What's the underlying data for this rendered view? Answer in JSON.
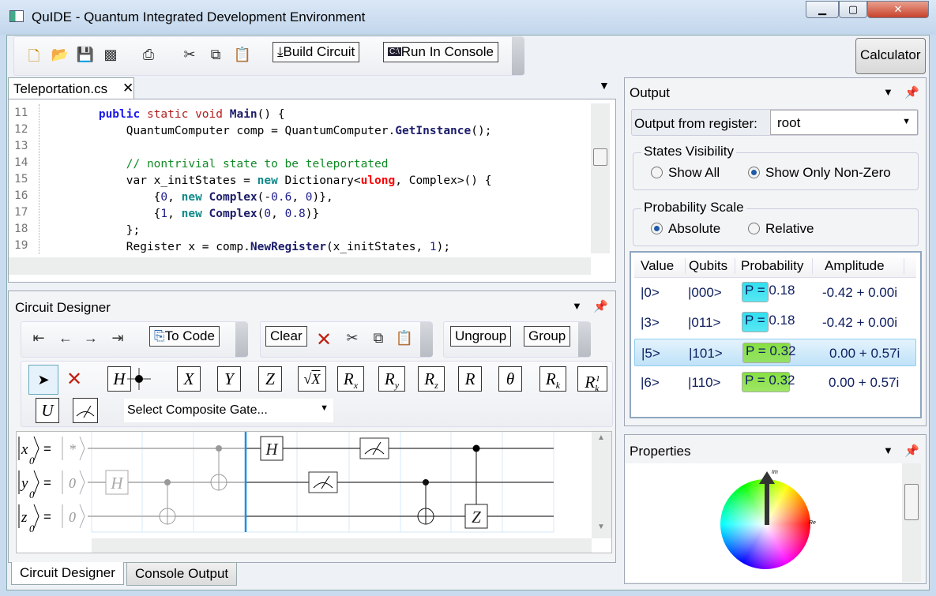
{
  "window": {
    "title": "QuIDE - Quantum Integrated Development Environment",
    "controls": [
      "minimize",
      "maximize",
      "close"
    ]
  },
  "toolbar": {
    "icons": [
      "new-file-icon",
      "open-file-icon",
      "save-icon",
      "save-all-icon",
      "print-icon",
      "cut-icon",
      "copy-icon",
      "paste-icon"
    ],
    "build_circuit": "Build Circuit",
    "run_in_console": "Run In Console",
    "calculator": "Calculator"
  },
  "editor": {
    "tab": "Teleportation.cs",
    "lines": [
      {
        "n": "11",
        "tokens": [
          [
            "        ",
            ""
          ],
          [
            "public",
            "kw"
          ],
          [
            " static void ",
            "red"
          ],
          [
            "Main",
            "m"
          ],
          [
            "() {",
            ""
          ]
        ]
      },
      {
        "n": "12",
        "tokens": [
          [
            "            QuantumComputer comp = QuantumComputer.",
            ""
          ],
          [
            "GetInstance",
            "m"
          ],
          [
            "();",
            ""
          ]
        ]
      },
      {
        "n": "13",
        "tokens": []
      },
      {
        "n": "14",
        "tokens": [
          [
            "            // nontrivial state to be teleportated",
            "cm"
          ]
        ]
      },
      {
        "n": "15",
        "tokens": [
          [
            "            var x_initStates = ",
            ""
          ],
          [
            "new",
            "teal"
          ],
          [
            " Dictionary<",
            ""
          ],
          [
            "ulong",
            "type"
          ],
          [
            ", Complex>() {",
            ""
          ]
        ]
      },
      {
        "n": "16",
        "tokens": [
          [
            "                {",
            ""
          ],
          [
            "0",
            "num"
          ],
          [
            ", ",
            ""
          ],
          [
            "new",
            "teal"
          ],
          [
            " ",
            ""
          ],
          [
            "Complex",
            "m"
          ],
          [
            "(-",
            ""
          ],
          [
            "0.6",
            "num"
          ],
          [
            ", ",
            ""
          ],
          [
            "0",
            "num"
          ],
          [
            ")},",
            ""
          ]
        ]
      },
      {
        "n": "17",
        "tokens": [
          [
            "                {",
            ""
          ],
          [
            "1",
            "num"
          ],
          [
            ", ",
            ""
          ],
          [
            "new",
            "teal"
          ],
          [
            " ",
            ""
          ],
          [
            "Complex",
            "m"
          ],
          [
            "(",
            ""
          ],
          [
            "0",
            "num"
          ],
          [
            ", ",
            ""
          ],
          [
            "0.8",
            "num"
          ],
          [
            ")}",
            ""
          ]
        ]
      },
      {
        "n": "18",
        "tokens": [
          [
            "            };",
            ""
          ]
        ]
      },
      {
        "n": "19",
        "tokens": [
          [
            "            Register x = comp.",
            ""
          ],
          [
            "NewRegister",
            "m"
          ],
          [
            "(x_initStates, ",
            ""
          ],
          [
            "1",
            "num"
          ],
          [
            ");",
            ""
          ]
        ]
      }
    ]
  },
  "circuit_designer": {
    "title": "Circuit Designer",
    "to_code": "To Code",
    "clear": "Clear",
    "ungroup": "Ungroup",
    "group": "Group",
    "gates": [
      "H",
      "X",
      "Y",
      "Z",
      "√X",
      "Rx",
      "Ry",
      "Rz",
      "R",
      "θ",
      "Rk",
      "Rk-1",
      "U"
    ],
    "composite": "Select Composite Gate...",
    "registers": [
      {
        "name": "x",
        "sub": "0",
        "init": "*"
      },
      {
        "name": "y",
        "sub": "0",
        "init": "0"
      },
      {
        "name": "z",
        "sub": "0",
        "init": "0"
      }
    ],
    "gate_H": "H",
    "gate_Z": "Z"
  },
  "bottom_tabs": [
    "Circuit Designer",
    "Console Output"
  ],
  "output": {
    "title": "Output",
    "register_label": "Output from register:",
    "register_value": "root",
    "states_visibility": {
      "label": "States Visibility",
      "options": [
        "Show All",
        "Show Only Non-Zero"
      ],
      "selected": "Show Only Non-Zero"
    },
    "probability_scale": {
      "label": "Probability Scale",
      "options": [
        "Absolute",
        "Relative"
      ],
      "selected": "Absolute"
    },
    "columns": [
      "Value",
      "Qubits",
      "Probability",
      "Amplitude"
    ],
    "rows": [
      {
        "value": "|0>",
        "qubits": "|000>",
        "probability": "P = 0.18",
        "p": 0.18,
        "amplitude": "-0.42 + 0.00i",
        "color": "#2fe0f0"
      },
      {
        "value": "|3>",
        "qubits": "|011>",
        "probability": "P = 0.18",
        "p": 0.18,
        "amplitude": "-0.42 + 0.00i",
        "color": "#2fe0f0"
      },
      {
        "value": "|5>",
        "qubits": "|101>",
        "probability": "P = 0.32",
        "p": 0.32,
        "amplitude": "0.00 + 0.57i",
        "color": "#86e040",
        "selected": true
      },
      {
        "value": "|6>",
        "qubits": "|110>",
        "probability": "P = 0.32",
        "p": 0.32,
        "amplitude": "0.00 + 0.57i",
        "color": "#86e040"
      }
    ]
  },
  "properties": {
    "title": "Properties",
    "axis_im": "Im",
    "axis_re": "Re"
  }
}
